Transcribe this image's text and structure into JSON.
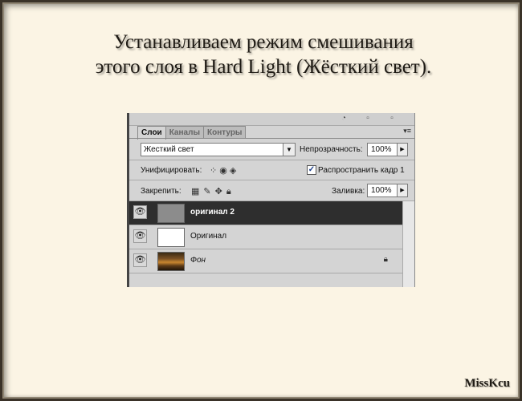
{
  "slide": {
    "title_line1": "Устанавливаем режим смешивания",
    "title_line2": "этого слоя в Hard Light (Жёсткий свет).",
    "signature": "MissKcu"
  },
  "panel": {
    "tabs": [
      {
        "label": "Слои",
        "active": true
      },
      {
        "label": "Каналы",
        "active": false
      },
      {
        "label": "Контуры",
        "active": false
      }
    ],
    "menu_icon": "▾≡",
    "blend_mode": "Жесткий свет",
    "opacity_label": "Непрозрачность:",
    "opacity_value": "100%",
    "unify_label": "Унифицировать:",
    "propagate_label": "Распространить кадр 1",
    "propagate_checked": true,
    "lock_label": "Закрепить:",
    "fill_label": "Заливка:",
    "fill_value": "100%",
    "layers": [
      {
        "name": "оригинал 2",
        "selected": true,
        "thumb": "gray"
      },
      {
        "name": "Оригинал",
        "selected": false,
        "thumb": "white"
      },
      {
        "name": "Фон",
        "selected": false,
        "thumb": "photo",
        "locked": true
      }
    ]
  },
  "icons": {
    "eye": "eye-icon",
    "lock": "lock-icon",
    "dropdown": "chevron-down-icon",
    "stepper": "chevron-right-icon"
  }
}
